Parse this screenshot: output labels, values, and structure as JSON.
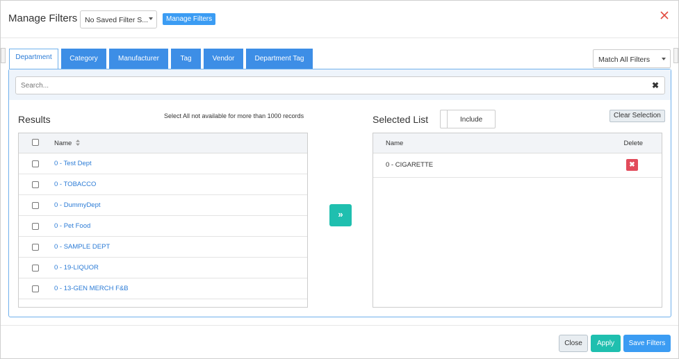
{
  "header": {
    "title": "Manage Filters",
    "saved_filter_value": "No Saved Filter S...",
    "manage_button_label": "Manage Filters",
    "close_glyph": "✕"
  },
  "tabs": [
    {
      "label": "Department",
      "active": true
    },
    {
      "label": "Category",
      "active": false
    },
    {
      "label": "Manufacturer",
      "active": false
    },
    {
      "label": "Tag",
      "active": false
    },
    {
      "label": "Vendor",
      "active": false
    },
    {
      "label": "Department Tag",
      "active": false
    }
  ],
  "match": {
    "value": "Match All Filters"
  },
  "search": {
    "placeholder": "Search...",
    "clear_glyph": "✖"
  },
  "results": {
    "title": "Results",
    "note": "Select All not available for more than 1000 records",
    "column_name": "Name",
    "rows": [
      "0 - Test Dept",
      "0 - TOBACCO",
      "0 - DummyDept",
      "0 - Pet Food",
      "0 - SAMPLE DEPT",
      "0 - 19-LIQUOR",
      "0 - 13-GEN MERCH F&B"
    ]
  },
  "move_glyph": "»",
  "selected": {
    "title": "Selected List",
    "include_label": "Include",
    "clear_label": "Clear Selection",
    "column_name": "Name",
    "column_delete": "Delete",
    "rows": [
      "0 - CIGARETTE"
    ],
    "delete_glyph": "✖"
  },
  "footer": {
    "close_label": "Close",
    "apply_label": "Apply",
    "save_label": "Save Filters"
  },
  "colors": {
    "primary": "#3b9cf3",
    "tab": "#3d8ee6",
    "teal": "#1fbfaf",
    "danger": "#e24b5b",
    "close_x": "#e24b3f"
  }
}
